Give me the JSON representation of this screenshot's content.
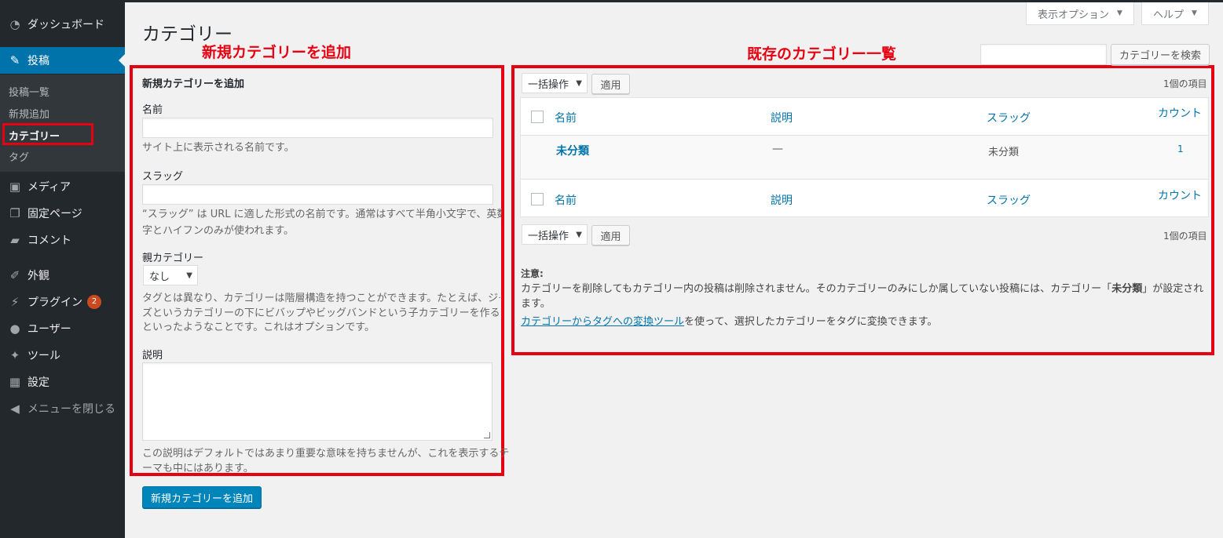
{
  "sidebar": {
    "dashboard": "ダッシュボード",
    "posts": "投稿",
    "sub": [
      "投稿一覧",
      "新規追加",
      "カテゴリー",
      "タグ"
    ],
    "media": "メディア",
    "pages": "固定ページ",
    "comments": "コメント",
    "appearance": "外観",
    "plugins": "プラグイン",
    "plugins_badge": "2",
    "users": "ユーザー",
    "tools": "ツール",
    "settings": "設定",
    "collapse": "メニューを閉じる"
  },
  "header": {
    "title": "カテゴリー",
    "screen_options": "表示オプション",
    "help": "ヘルプ"
  },
  "annotations": {
    "left": "新規カテゴリーを追加",
    "right": "既存のカテゴリー一覧",
    "color": "#e60012"
  },
  "form": {
    "heading": "新規カテゴリーを追加",
    "name_label": "名前",
    "name_value": "",
    "name_desc": "サイト上に表示される名前です。",
    "slug_label": "スラッグ",
    "slug_value": "",
    "slug_desc_1": "“スラッグ” は URL に適した形式の名前です。通常はすべて半角小文字で、英数",
    "slug_desc_2": "字とハイフンのみが使われます。",
    "parent_label": "親カテゴリー",
    "parent_value": "なし",
    "parent_desc_1": "タグとは異なり、カテゴリーは階層構造を持つことができます。たとえば、ジャ",
    "parent_desc_2": "ズというカテゴリーの下にビバップやビッグバンドという子カテゴリーを作る、",
    "parent_desc_3": "といったようなことです。これはオプションです。",
    "desc_label": "説明",
    "desc_value": "",
    "desc_desc_1": "この説明はデフォルトではあまり重要な意味を持ちませんが、これを表示するテ",
    "desc_desc_2": "ーマも中にはあります。",
    "submit": "新規カテゴリーを追加"
  },
  "list": {
    "search_value": "",
    "search_button": "カテゴリーを検索",
    "bulk_action": "一括操作",
    "apply": "適用",
    "items_count": "1個の項目",
    "columns": {
      "name": "名前",
      "description": "説明",
      "slug": "スラッグ",
      "count": "カウント"
    },
    "rows": [
      {
        "name": "未分類",
        "description": "—",
        "slug": "未分類",
        "count": "1"
      }
    ],
    "note_label": "注意:",
    "note_1a": "カテゴリーを削除してもカテゴリー内の投稿は削除されません。そのカテゴリーのみにしか属していない投稿には、カテゴリー「",
    "note_1b": "未分類",
    "note_1c": "」が設定され",
    "note_2": "ます。",
    "note_link": "カテゴリーからタグへの変換ツール",
    "note_3": "を使って、選択したカテゴリーをタグに変換できます。"
  }
}
